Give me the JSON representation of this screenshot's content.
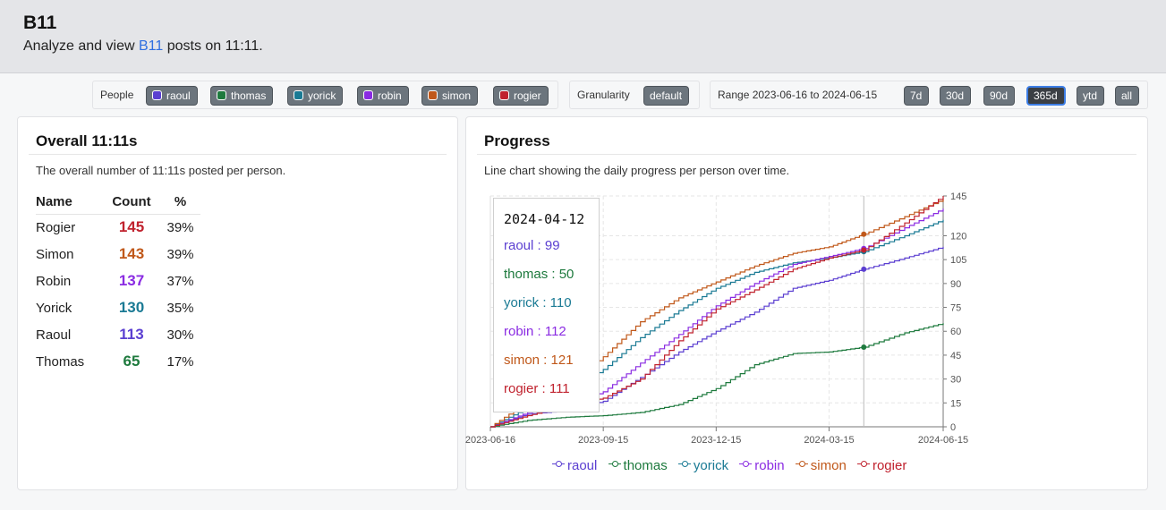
{
  "header": {
    "title": "B11",
    "subtitle_prefix": "Analyze and view ",
    "subtitle_link": "B11",
    "subtitle_suffix": " posts on 11:11."
  },
  "filters": {
    "people_label": "People",
    "people": [
      {
        "name": "raoul",
        "color": "#5b3fd1"
      },
      {
        "name": "thomas",
        "color": "#1e7a3e"
      },
      {
        "name": "yorick",
        "color": "#1a7a94"
      },
      {
        "name": "robin",
        "color": "#8a2be2"
      },
      {
        "name": "simon",
        "color": "#c0581a"
      },
      {
        "name": "rogier",
        "color": "#c0222e"
      }
    ],
    "granularity_label": "Granularity",
    "granularity_value": "default",
    "range_label": "Range 2023-06-16 to 2024-06-15",
    "range_options": [
      "7d",
      "30d",
      "90d",
      "365d",
      "ytd",
      "all"
    ],
    "range_active": "365d"
  },
  "overall": {
    "title": "Overall 11:11s",
    "description": "The overall number of 11:11s posted per person.",
    "columns": [
      "Name",
      "Count",
      "%"
    ],
    "rows": [
      {
        "name": "Rogier",
        "count": "145",
        "pct": "39%",
        "color": "#c0222e"
      },
      {
        "name": "Simon",
        "count": "143",
        "pct": "39%",
        "color": "#c0581a"
      },
      {
        "name": "Robin",
        "count": "137",
        "pct": "37%",
        "color": "#8a2be2"
      },
      {
        "name": "Yorick",
        "count": "130",
        "pct": "35%",
        "color": "#1a7a94"
      },
      {
        "name": "Raoul",
        "count": "113",
        "pct": "30%",
        "color": "#5b3fd1"
      },
      {
        "name": "Thomas",
        "count": "65",
        "pct": "17%",
        "color": "#1e7a3e"
      }
    ]
  },
  "progress": {
    "title": "Progress",
    "description": "Line chart showing the daily progress per person over time.",
    "tooltip": {
      "date": "2024-04-12",
      "rows": [
        {
          "label": "raoul : 99",
          "color": "#5b3fd1"
        },
        {
          "label": "thomas : 50",
          "color": "#1e7a3e"
        },
        {
          "label": "yorick : 110",
          "color": "#1a7a94"
        },
        {
          "label": "robin : 112",
          "color": "#8a2be2"
        },
        {
          "label": "simon : 121",
          "color": "#c0581a"
        },
        {
          "label": "rogier : 111",
          "color": "#c0222e"
        }
      ]
    }
  },
  "chart_data": {
    "type": "line",
    "title": "",
    "xlabel": "",
    "ylabel": "",
    "x_range": [
      "2023-06-16",
      "2024-06-15"
    ],
    "x_ticks": [
      "2023-06-16",
      "2023-09-15",
      "2023-12-15",
      "2024-03-15",
      "2024-06-15"
    ],
    "y_ticks": [
      0,
      15,
      30,
      45,
      60,
      75,
      90,
      105,
      120,
      145
    ],
    "ylim": [
      0,
      145
    ],
    "grid": true,
    "legend_position": "bottom",
    "cursor_date": "2024-04-12",
    "series": [
      {
        "name": "raoul",
        "color": "#5b3fd1",
        "x": [
          "2023-06-16",
          "2023-07-16",
          "2023-08-16",
          "2023-09-15",
          "2023-10-15",
          "2023-11-15",
          "2023-12-15",
          "2024-01-15",
          "2024-02-15",
          "2024-03-15",
          "2024-04-12",
          "2024-05-15",
          "2024-06-15"
        ],
        "y": [
          0,
          8,
          10,
          16,
          31,
          47,
          60,
          72,
          87,
          92,
          99,
          106,
          113
        ]
      },
      {
        "name": "thomas",
        "color": "#1e7a3e",
        "x": [
          "2023-06-16",
          "2023-07-16",
          "2023-08-16",
          "2023-09-15",
          "2023-10-15",
          "2023-11-15",
          "2023-12-15",
          "2024-01-15",
          "2024-02-15",
          "2024-03-15",
          "2024-04-12",
          "2024-05-15",
          "2024-06-15"
        ],
        "y": [
          0,
          4,
          6,
          7,
          9,
          14,
          24,
          39,
          46,
          47,
          50,
          59,
          65
        ]
      },
      {
        "name": "yorick",
        "color": "#1a7a94",
        "x": [
          "2023-06-16",
          "2023-07-16",
          "2023-08-16",
          "2023-09-15",
          "2023-10-15",
          "2023-11-15",
          "2023-12-15",
          "2024-01-15",
          "2024-02-15",
          "2024-03-15",
          "2024-04-12",
          "2024-05-15",
          "2024-06-15"
        ],
        "y": [
          0,
          12,
          20,
          36,
          56,
          73,
          87,
          97,
          103,
          106,
          110,
          120,
          130
        ]
      },
      {
        "name": "robin",
        "color": "#8a2be2",
        "x": [
          "2023-06-16",
          "2023-07-16",
          "2023-08-16",
          "2023-09-15",
          "2023-10-15",
          "2023-11-15",
          "2023-12-15",
          "2024-01-15",
          "2024-02-15",
          "2024-03-15",
          "2024-04-12",
          "2024-05-15",
          "2024-06-15"
        ],
        "y": [
          0,
          9,
          12,
          22,
          40,
          58,
          76,
          90,
          102,
          107,
          112,
          125,
          137
        ]
      },
      {
        "name": "simon",
        "color": "#c0581a",
        "x": [
          "2023-06-16",
          "2023-07-16",
          "2023-08-16",
          "2023-09-15",
          "2023-10-15",
          "2023-11-15",
          "2023-12-15",
          "2024-01-15",
          "2024-02-15",
          "2024-03-15",
          "2024-04-12",
          "2024-05-15",
          "2024-06-15"
        ],
        "y": [
          0,
          16,
          24,
          44,
          66,
          81,
          91,
          101,
          109,
          113,
          121,
          132,
          143
        ]
      },
      {
        "name": "rogier",
        "color": "#c0222e",
        "x": [
          "2023-06-16",
          "2023-07-16",
          "2023-08-16",
          "2023-09-15",
          "2023-10-15",
          "2023-11-15",
          "2023-12-15",
          "2024-01-15",
          "2024-02-15",
          "2024-03-15",
          "2024-04-12",
          "2024-05-15",
          "2024-06-15"
        ],
        "y": [
          0,
          7,
          13,
          18,
          30,
          54,
          74,
          86,
          99,
          106,
          111,
          128,
          145
        ]
      }
    ]
  }
}
